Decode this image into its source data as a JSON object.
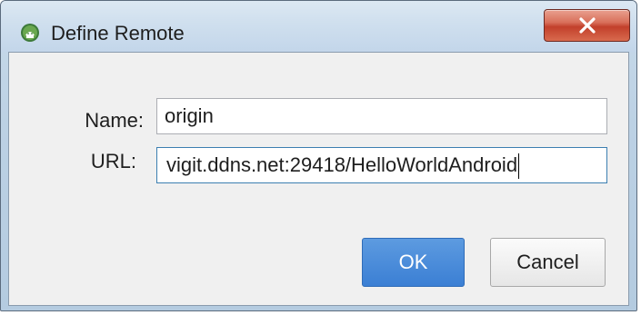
{
  "window": {
    "title": "Define Remote",
    "icon": "android-studio-icon",
    "close_icon": "close-x-icon"
  },
  "form": {
    "name_label": "Name:",
    "name_value": "origin",
    "url_label": "URL:",
    "url_value": "vigit.ddns.net:29418/HelloWorldAndroid"
  },
  "buttons": {
    "ok_label": "OK",
    "cancel_label": "Cancel"
  },
  "colors": {
    "ok_accent": "#3b7fd4",
    "close_red": "#c2402b",
    "focus_border": "#3c7fb1"
  }
}
